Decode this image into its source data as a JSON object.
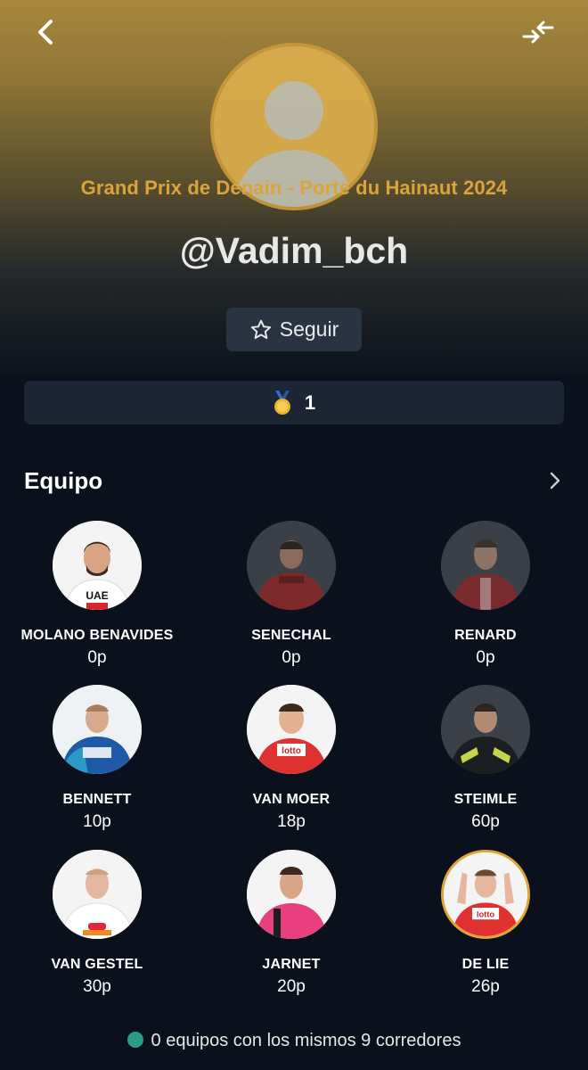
{
  "header": {
    "back_icon": "chevron-left-icon",
    "swap_icon": "compare-arrows-icon"
  },
  "profile": {
    "race_title": "Grand Prix de Denain - Porte du Hainaut 2024",
    "username": "@Vadim_bch",
    "follow_label": "Seguir",
    "medals": "1"
  },
  "team": {
    "title": "Equipo",
    "riders": [
      {
        "name": "MOLANO BENAVIDES",
        "points": "0p"
      },
      {
        "name": "SENECHAL",
        "points": "0p"
      },
      {
        "name": "RENARD",
        "points": "0p"
      },
      {
        "name": "BENNETT",
        "points": "10p"
      },
      {
        "name": "VAN MOER",
        "points": "18p"
      },
      {
        "name": "STEIMLE",
        "points": "60p"
      },
      {
        "name": "VAN GESTEL",
        "points": "30p"
      },
      {
        "name": "JARNET",
        "points": "20p"
      },
      {
        "name": "DE LIE",
        "points": "26p"
      }
    ]
  },
  "footer": {
    "text": "0 equipos con los mismos 9 corredores"
  },
  "colors": {
    "accent_gold": "#d9a53b",
    "background": "#0a111c",
    "card": "#1c2534",
    "status_dot": "#2c9a86"
  }
}
